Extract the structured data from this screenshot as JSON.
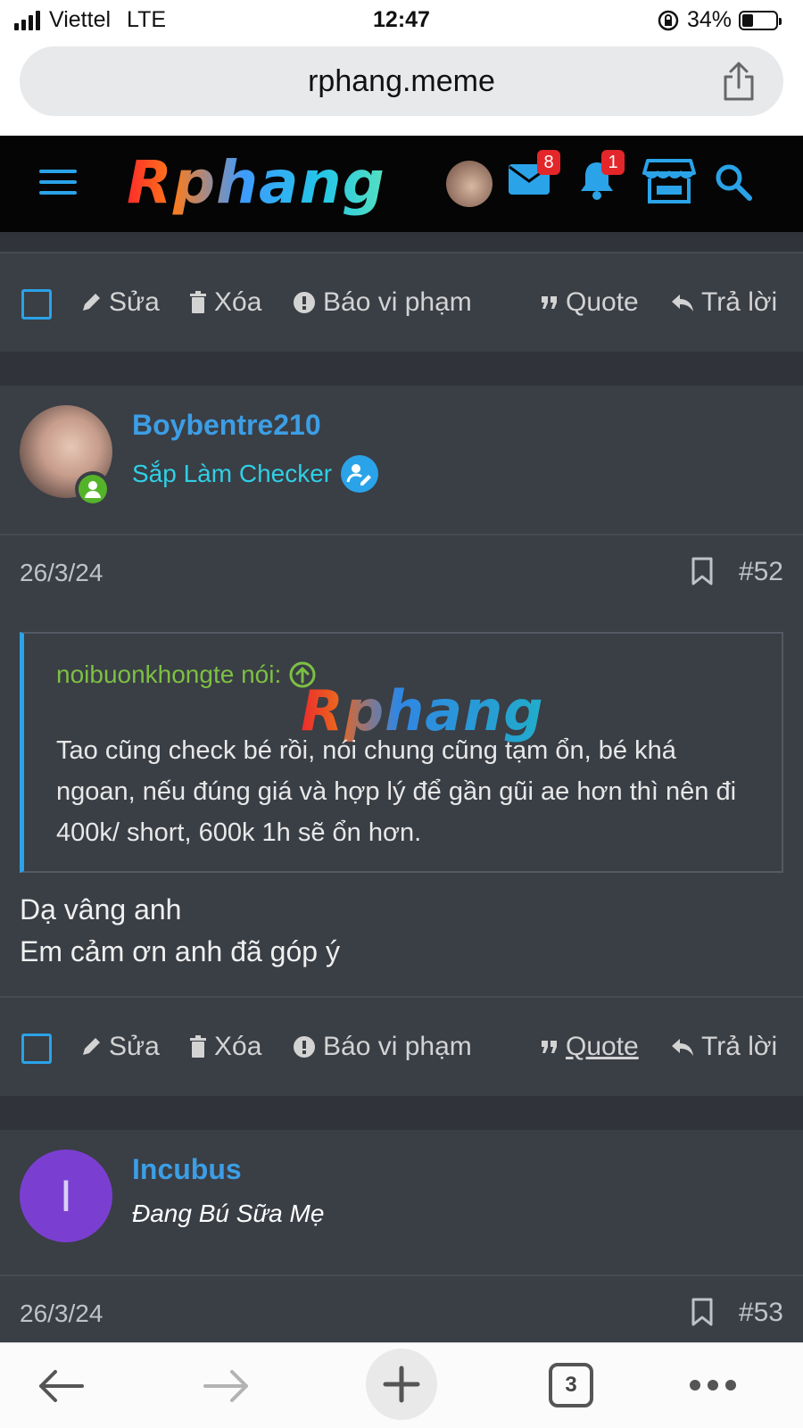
{
  "status_bar": {
    "carrier": "Viettel",
    "network": "LTE",
    "time": "12:47",
    "battery_percent": "34%",
    "battery_level": 0.34
  },
  "browser": {
    "url": "rphang.meme",
    "share_icon": "share-icon",
    "tab_count": "3"
  },
  "site_header": {
    "logo": "Rphang",
    "messages_badge": "8",
    "alerts_badge": "1",
    "accent_color": "#2aa3e8"
  },
  "actions": {
    "edit": "Sửa",
    "delete": "Xóa",
    "report": "Báo vi phạm",
    "quote": "Quote",
    "reply": "Trả lời"
  },
  "posts": [
    {
      "username": "Boybentre210",
      "user_title": "Sắp Làm Checker",
      "date": "26/3/24",
      "number": "#52",
      "quote": {
        "author": "noibuonkhongte nói:",
        "text": "Tao cũng check bé rồi, nói chung cũng tạm ổn, bé khá ngoan, nếu đúng giá và hợp lý để gần gũi ae hơn thì nên đi 400k/ short, 600k 1h sẽ ổn hơn.",
        "watermark": "Rphang"
      },
      "body_line1": "Dạ vâng anh",
      "body_line2": "Em cảm ơn anh đã góp ý"
    },
    {
      "username": "Incubus",
      "user_title": "Đang Bú Sữa Mẹ",
      "avatar_letter": "I",
      "avatar_color": "#7a3fd0",
      "date": "26/3/24",
      "number": "#53"
    }
  ]
}
